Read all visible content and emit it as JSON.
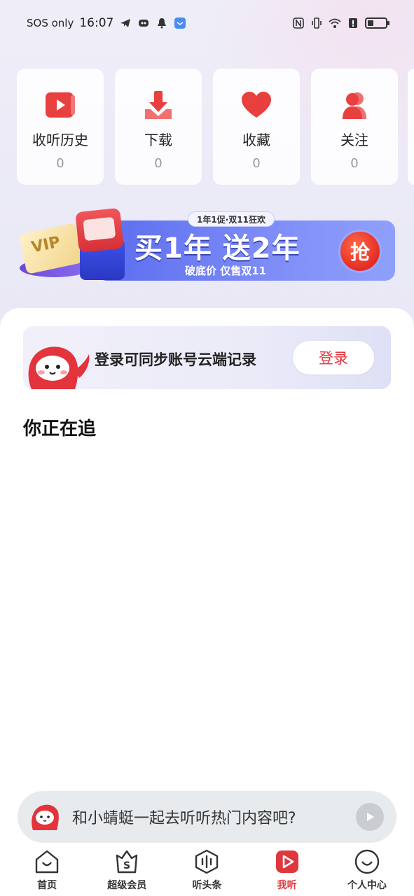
{
  "status_bar": {
    "carrier": "SOS only",
    "time": "16:07"
  },
  "quick_actions": [
    {
      "label": "收听历史",
      "count": "0",
      "icon": "history-play-icon"
    },
    {
      "label": "下载",
      "count": "0",
      "icon": "download-icon"
    },
    {
      "label": "收藏",
      "count": "0",
      "icon": "heart-icon"
    },
    {
      "label": "关注",
      "count": "0",
      "icon": "follow-user-icon"
    }
  ],
  "banner": {
    "tag": "1年1促·双11狂欢",
    "title": "买1年 送2年",
    "subtitle": "破底价 仅售双11",
    "cta": "抢",
    "vip": "VIP"
  },
  "login_prompt": {
    "text": "登录可同步账号云端记录",
    "button": "登录"
  },
  "section": {
    "title": "你正在追"
  },
  "mini_player": {
    "text": "和小蜻蜓一起去听听热门内容吧?"
  },
  "tabs": [
    {
      "label": "首页",
      "icon": "home-icon",
      "active": false
    },
    {
      "label": "超级会员",
      "icon": "vip-bag-icon",
      "active": false
    },
    {
      "label": "听头条",
      "icon": "audio-wave-icon",
      "active": false
    },
    {
      "label": "我听",
      "icon": "play-square-icon",
      "active": true
    },
    {
      "label": "个人中心",
      "icon": "smile-user-icon",
      "active": false
    }
  ],
  "colors": {
    "brand_red": "#e0363d",
    "banner_blue": "#5a6cf0"
  }
}
